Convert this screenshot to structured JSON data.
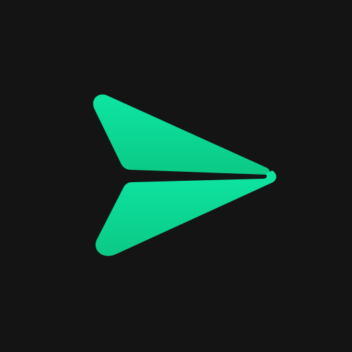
{
  "icon": {
    "name": "send-paper-plane-icon",
    "colors": {
      "background": "#141414",
      "glyph_top": "#0EE5A2",
      "glyph_bottom": "#0BC985"
    }
  }
}
